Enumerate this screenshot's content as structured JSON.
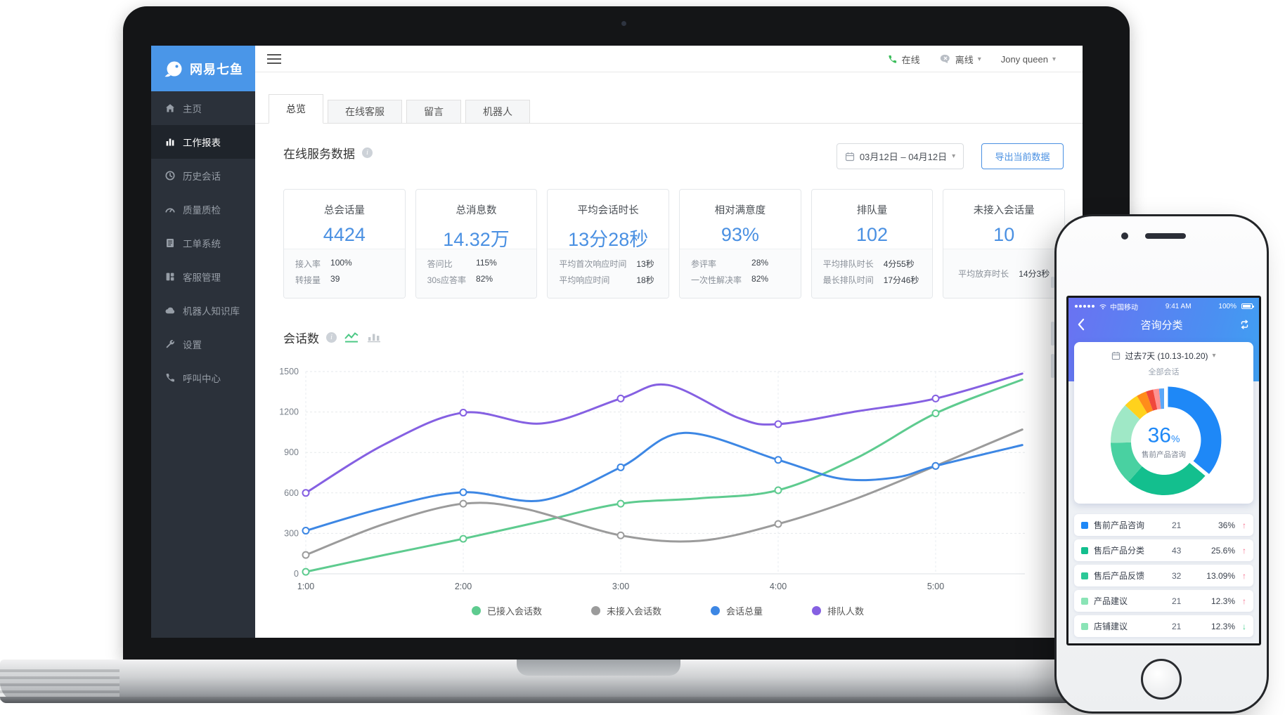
{
  "icons": {
    "caret_down": "▾",
    "info": "i"
  },
  "laptop": {
    "sidebar": {
      "brand": "网易七鱼",
      "items": [
        {
          "label": "主页",
          "icon": "home"
        },
        {
          "label": "工作报表",
          "icon": "report",
          "active": true
        },
        {
          "label": "历史会话",
          "icon": "history"
        },
        {
          "label": "质量质检",
          "icon": "quality"
        },
        {
          "label": "工单系统",
          "icon": "ticket"
        },
        {
          "label": "客服管理",
          "icon": "agents"
        },
        {
          "label": "机器人知识库",
          "icon": "robot"
        },
        {
          "label": "设置",
          "icon": "settings"
        },
        {
          "label": "呼叫中心",
          "icon": "call"
        }
      ]
    },
    "topbar": {
      "online": "在线",
      "offline": "离线",
      "user": "Jony queen"
    },
    "tabs": [
      {
        "label": "总览",
        "active": true
      },
      {
        "label": "在线客服"
      },
      {
        "label": "留言"
      },
      {
        "label": "机器人"
      }
    ],
    "overview": {
      "title": "在线服务数据",
      "date_range": "03月12日 – 04月12日",
      "export": "导出当前数据",
      "cards": [
        {
          "title": "总会话量",
          "value": "4424",
          "stats": [
            {
              "label": "接入率",
              "value": "100%"
            },
            {
              "label": "转接量",
              "value": "39"
            }
          ]
        },
        {
          "title": "总消息数",
          "value": "14.32万",
          "stats": [
            {
              "label": "答问比",
              "value": "115%"
            },
            {
              "label": "30s应答率",
              "value": "82%"
            }
          ]
        },
        {
          "title": "平均会话时长",
          "value": "13分28秒",
          "stats": [
            {
              "label": "平均首次响应时间",
              "value": "13秒"
            },
            {
              "label": "平均响应时间",
              "value": "18秒"
            }
          ]
        },
        {
          "title": "相对满意度",
          "value": "93%",
          "stats": [
            {
              "label": "参评率",
              "value": "28%"
            },
            {
              "label": "一次性解决率",
              "value": "82%"
            }
          ]
        },
        {
          "title": "排队量",
          "value": "102",
          "stats": [
            {
              "label": "平均排队时长",
              "value": "4分55秒"
            },
            {
              "label": "最长排队时间",
              "value": "17分46秒"
            }
          ]
        },
        {
          "title": "未接入会话量",
          "value": "10",
          "stats": [
            {
              "label": "平均放弃时长",
              "value": "14分3秒"
            }
          ]
        }
      ]
    },
    "chart_section_title": "会话数"
  },
  "chart_data": [
    {
      "type": "line",
      "title": "会话数",
      "x_ticks": [
        "1:00",
        "2:00",
        "3:00",
        "4:00",
        "5:00"
      ],
      "y_ticks": [
        0,
        300,
        600,
        900,
        1200,
        1500
      ],
      "ylim": [
        0,
        1500
      ],
      "grid": "dashed",
      "legend_position": "bottom",
      "series": [
        {
          "name": "已接入会话数",
          "color": "#5ecb8f",
          "points": [
            [
              1,
              15
            ],
            [
              1.5,
              140
            ],
            [
              2,
              260
            ],
            [
              2.5,
              390
            ],
            [
              3,
              520
            ],
            [
              3.5,
              560
            ],
            [
              4,
              620
            ],
            [
              4.5,
              860
            ],
            [
              5,
              1190
            ],
            [
              5.55,
              1440
            ]
          ],
          "markers": [
            1,
            2,
            3,
            4,
            5
          ]
        },
        {
          "name": "未接入会话数",
          "color": "#9b9b9b",
          "points": [
            [
              1,
              140
            ],
            [
              1.5,
              370
            ],
            [
              2,
              520
            ],
            [
              2.4,
              480
            ],
            [
              3,
              285
            ],
            [
              3.5,
              245
            ],
            [
              4,
              370
            ],
            [
              4.5,
              560
            ],
            [
              5,
              800
            ],
            [
              5.55,
              1070
            ]
          ],
          "markers": [
            1,
            2,
            3,
            4,
            5
          ]
        },
        {
          "name": "会话总量",
          "color": "#3d87e4",
          "points": [
            [
              1,
              320
            ],
            [
              1.5,
              490
            ],
            [
              2,
              605
            ],
            [
              2.5,
              545
            ],
            [
              3,
              790
            ],
            [
              3.4,
              1045
            ],
            [
              4,
              845
            ],
            [
              4.4,
              705
            ],
            [
              4.75,
              715
            ],
            [
              5,
              800
            ],
            [
              5.55,
              955
            ]
          ],
          "markers": [
            1,
            2,
            3,
            4,
            5
          ]
        },
        {
          "name": "排队人数",
          "color": "#8560e2",
          "points": [
            [
              1,
              600
            ],
            [
              1.5,
              960
            ],
            [
              2,
              1195
            ],
            [
              2.5,
              1115
            ],
            [
              3,
              1300
            ],
            [
              3.3,
              1400
            ],
            [
              3.75,
              1155
            ],
            [
              4,
              1110
            ],
            [
              4.5,
              1205
            ],
            [
              5,
              1300
            ],
            [
              5.55,
              1485
            ]
          ],
          "markers": [
            1,
            2,
            3,
            4,
            5
          ]
        }
      ]
    },
    {
      "type": "pie",
      "center_value": "36",
      "center_unit": "%",
      "center_label": "售前产品咨询",
      "slices": [
        {
          "label": "售前产品咨询",
          "value": 36,
          "color": "#1e88f7",
          "exploded": true
        },
        {
          "label": "售后产品分类",
          "value": 25.6,
          "color": "#13bf8e"
        },
        {
          "label": "售后产品反馈",
          "value": 13.09,
          "color": "#49d1a1"
        },
        {
          "label": "产品建议",
          "value": 12.3,
          "color": "#9fe8c6"
        },
        {
          "value": 4.5,
          "color": "#ffd21c"
        },
        {
          "value": 3.0,
          "color": "#ff8c1a"
        },
        {
          "value": 2.2,
          "color": "#f0483c"
        },
        {
          "value": 1.8,
          "color": "#ff9292"
        },
        {
          "value": 1.51,
          "color": "#5aa7f8"
        }
      ]
    }
  ],
  "phone": {
    "status": {
      "carrier": "中国移动",
      "time": "9:41 AM",
      "battery": "100%"
    },
    "nav_title": "咨询分类",
    "filter": {
      "range": "过去7天 (10.13-10.20)",
      "scope": "全部会话"
    },
    "rows": [
      {
        "label": "售前产品咨询",
        "count": "21",
        "pct": "36%",
        "arrow": "↑",
        "dir": "up",
        "color": "#1e88f7"
      },
      {
        "label": "售后产品分类",
        "count": "43",
        "pct": "25.6%",
        "arrow": "↑",
        "dir": "up",
        "color": "#13bf8e"
      },
      {
        "label": "售后产品反馈",
        "count": "32",
        "pct": "13.09%",
        "arrow": "↑",
        "dir": "up",
        "color": "#2bc897"
      },
      {
        "label": "产品建议",
        "count": "21",
        "pct": "12.3%",
        "arrow": "↑",
        "dir": "up",
        "color": "#8ae4b6"
      },
      {
        "label": "店铺建议",
        "count": "21",
        "pct": "12.3%",
        "arrow": "↓",
        "dir": "down",
        "color": "#8ae4b6"
      }
    ]
  }
}
